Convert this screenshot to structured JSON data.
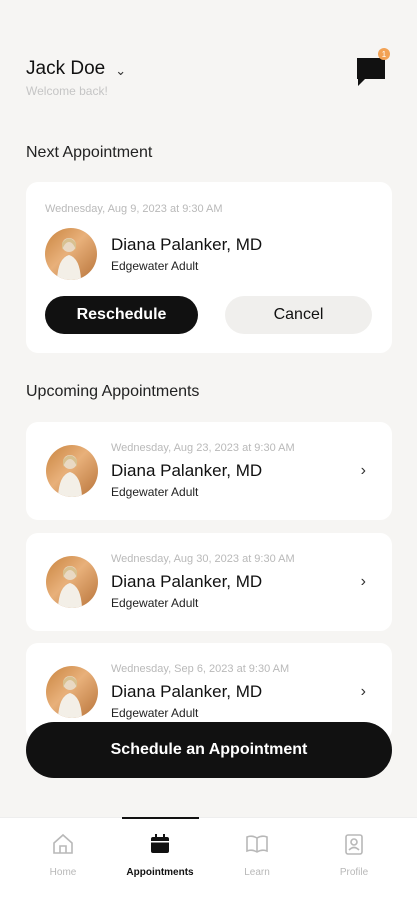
{
  "header": {
    "user_name": "Jack Doe",
    "welcome": "Welcome back!",
    "notification_count": "1"
  },
  "next_section": {
    "title": "Next Appointment",
    "date": "Wednesday, Aug 9, 2023 at 9:30 AM",
    "doctor": "Diana Palanker, MD",
    "location": "Edgewater Adult",
    "reschedule_label": "Reschedule",
    "cancel_label": "Cancel"
  },
  "upcoming_section": {
    "title": "Upcoming Appointments",
    "items": [
      {
        "date": "Wednesday, Aug 23, 2023 at 9:30 AM",
        "doctor": "Diana Palanker, MD",
        "location": "Edgewater Adult"
      },
      {
        "date": "Wednesday, Aug 30, 2023 at 9:30 AM",
        "doctor": "Diana Palanker, MD",
        "location": "Edgewater Adult"
      },
      {
        "date": "Wednesday, Sep 6, 2023 at 9:30 AM",
        "doctor": "Diana Palanker, MD",
        "location": "Edgewater Adult"
      }
    ]
  },
  "schedule_button": "Schedule an Appointment",
  "tabs": [
    {
      "label": "Home",
      "icon": "home-icon"
    },
    {
      "label": "Appointments",
      "icon": "calendar-icon"
    },
    {
      "label": "Learn",
      "icon": "book-icon"
    },
    {
      "label": "Profile",
      "icon": "profile-icon"
    }
  ],
  "colors": {
    "background": "#f6f5f3",
    "primary": "#111111",
    "badge": "#f2a255"
  }
}
